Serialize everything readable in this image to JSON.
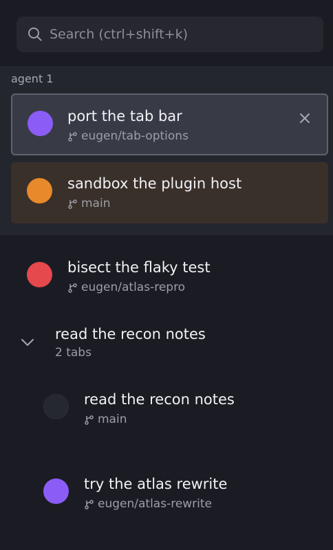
{
  "search": {
    "placeholder": "Search (ctrl+shift+k)"
  },
  "group": {
    "label": "agent 1",
    "items": [
      {
        "title": "port the tab bar",
        "branch": "eugen/tab-options",
        "dot_color": "#8b5cf6",
        "selected": true
      },
      {
        "title": "sandbox the plugin host",
        "branch": "main",
        "dot_color": "#e8892b"
      }
    ]
  },
  "items": [
    {
      "title": "bisect the flaky test",
      "branch": "eugen/atlas-repro",
      "dot_color": "#e5484d"
    }
  ],
  "tab_group": {
    "title": "read the recon notes",
    "count_label": "2 tabs",
    "expanded": true,
    "tabs": [
      {
        "title": "read the recon notes",
        "branch": "main",
        "dot_color": "#262830"
      },
      {
        "title": "try the atlas rewrite",
        "branch": "eugen/atlas-rewrite",
        "dot_color": "#8b5cf6"
      }
    ]
  },
  "colors": {
    "background": "#1b1c23",
    "group_background": "#24262d",
    "selected_background": "#383b45",
    "warm_background": "#3a302a"
  }
}
